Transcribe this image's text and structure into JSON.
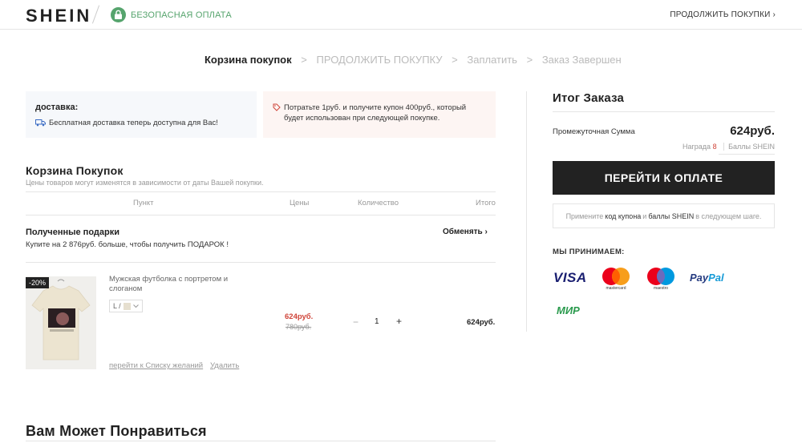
{
  "header": {
    "logo": "SHEIN",
    "secure_text": "БЕЗОПАСНАЯ ОПЛАТА",
    "continue_link": "ПРОДОЛЖИТЬ ПОКУПКИ ›"
  },
  "steps": [
    "Корзина покупок",
    "ПРОДОЛЖИТЬ ПОКУПКУ",
    "Заплатить",
    "Заказ Завершен"
  ],
  "step_separator": ">",
  "delivery": {
    "title": "доставка:",
    "text": "Бесплатная доставка теперь доступна для Вас!"
  },
  "coupon_promo": {
    "text": "Потратьте 1руб. и получите купон 400руб., который будет использован при следующей покупке."
  },
  "cart": {
    "title": "Корзина Покупок",
    "subtitle": "Цены товаров могут изменятся в зависимости от даты Вашей покупки.",
    "columns": [
      "Пункт",
      "Цены",
      "Количество",
      "Итого"
    ],
    "gifts_title": "Полученные подарки",
    "gifts_sub": "Купите на 2 876руб. больше, чтобы получить ПОДАРОК !",
    "exchange_label": "Обменять ›",
    "item": {
      "discount": "-20%",
      "name": "Мужская футболка с портретом и слоганом",
      "variant": "L /",
      "price_new": "624руб.",
      "price_old": "780руб.",
      "qty_minus": "−",
      "quantity": "1",
      "qty_plus": "+",
      "total": "624руб.",
      "wishlist_link": "перейти к Списку желаний",
      "delete_link": "Удалить"
    }
  },
  "recommend_title": "Вам Может Понравиться",
  "summary": {
    "title": "Итог Заказа",
    "subtotal_label": "Промежуточная Сумма",
    "subtotal_value": "624руб.",
    "reward_label": "Награда",
    "reward_value": "8",
    "points_label": "Баллы SHEIN",
    "pay_button": "ПЕРЕЙТИ К ОПЛАТЕ",
    "coupon_note_1": "Примените",
    "coupon_note_2": "код купона",
    "coupon_note_3": "и",
    "coupon_note_4": "баллы SHEIN",
    "coupon_note_5": "в следующем шаге.",
    "accept_label": "МЫ ПРИНИМАЕМ:",
    "payments": {
      "visa": "VISA",
      "mastercard": "mastercard",
      "maestro": "maestro",
      "paypal_1": "Pay",
      "paypal_2": "Pal",
      "mir": "МИР"
    }
  },
  "colors": {
    "secure_green": "#56a46d",
    "price_red": "#d0453a",
    "button_black": "#222222"
  }
}
